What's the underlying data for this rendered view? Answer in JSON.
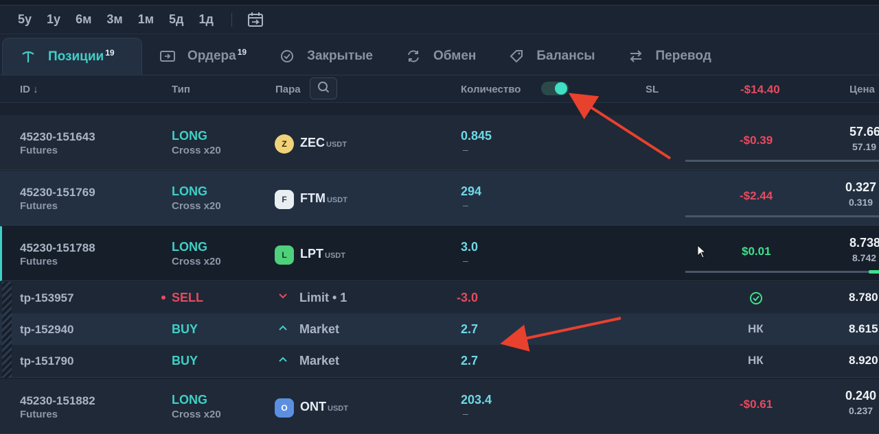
{
  "timeframes": [
    "5y",
    "1y",
    "6м",
    "3м",
    "1м",
    "5д",
    "1д"
  ],
  "tabs": [
    {
      "label": "Позиции",
      "badge": "19",
      "icon": "position-icon",
      "active": true
    },
    {
      "label": "Ордера",
      "badge": "19",
      "icon": "order-icon",
      "active": false
    },
    {
      "label": "Закрытые",
      "badge": "",
      "icon": "check-circle-icon",
      "active": false
    },
    {
      "label": "Обмен",
      "badge": "",
      "icon": "swap-icon",
      "active": false
    },
    {
      "label": "Балансы",
      "badge": "",
      "icon": "tag-icon",
      "active": false
    },
    {
      "label": "Перевод",
      "badge": "",
      "icon": "transfer-icon",
      "active": false
    }
  ],
  "columns": {
    "id": "ID ↓",
    "type": "Тип",
    "pair": "Пара",
    "qty": "Количество",
    "sl": "SL",
    "pnl_total": "-$14.40",
    "price": "Цена"
  },
  "positions": [
    {
      "id": "45230-151643",
      "kind": "Futures",
      "side": "LONG",
      "margin": "Cross x20",
      "coin": "ZEC",
      "quote": "USDT",
      "qty": "0.845",
      "qty_sub": "–",
      "pnl": "-$0.39",
      "price": "57.66",
      "price_sub": "57.19"
    },
    {
      "id": "45230-151769",
      "kind": "Futures",
      "side": "LONG",
      "margin": "Cross x20",
      "coin": "FTM",
      "quote": "USDT",
      "qty": "294",
      "qty_sub": "–",
      "pnl": "-$2.44",
      "price": "0.327",
      "price_sub": "0.319"
    },
    {
      "id": "45230-151788",
      "kind": "Futures",
      "side": "LONG",
      "margin": "Cross x20",
      "coin": "LPT",
      "quote": "USDT",
      "qty": "3.0",
      "qty_sub": "–",
      "pnl": "$0.01",
      "price": "8.738",
      "price_sub": "8.742"
    },
    {
      "id": "45230-151882",
      "kind": "Futures",
      "side": "LONG",
      "margin": "Cross x20",
      "coin": "ONT",
      "quote": "USDT",
      "qty": "203.4",
      "qty_sub": "–",
      "pnl": "-$0.61",
      "price": "0.240",
      "price_sub": "0.237"
    }
  ],
  "orders": [
    {
      "id": "tp-153957",
      "side": "SELL",
      "order_type": "Limit • 1",
      "qty": "-3.0",
      "sl": "",
      "price": "8.780"
    },
    {
      "id": "tp-152940",
      "side": "BUY",
      "order_type": "Market",
      "qty": "2.7",
      "sl": "НК",
      "price": "8.615"
    },
    {
      "id": "tp-151790",
      "side": "BUY",
      "order_type": "Market",
      "qty": "2.7",
      "sl": "НК",
      "price": "8.920"
    }
  ],
  "colors": {
    "accent": "#3fd0c6",
    "negative": "#e84a5f",
    "positive": "#3ee08a",
    "annotation": "#e8412e"
  }
}
